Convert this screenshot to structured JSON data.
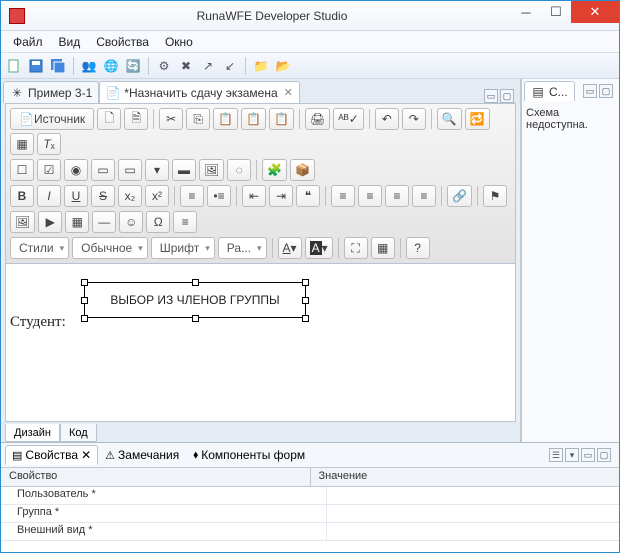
{
  "window": {
    "title": "RunaWFE Developer Studio"
  },
  "menu": {
    "file": "Файл",
    "view": "Вид",
    "properties": "Свойства",
    "window": "Окно"
  },
  "tabs": [
    {
      "label": "Пример 3-1"
    },
    {
      "label": "*Назначить сдачу экзамена"
    }
  ],
  "source_btn": "Источник",
  "style_combos": {
    "styles": "Стили",
    "format": "Обычное",
    "font": "Шрифт",
    "size": "Ра..."
  },
  "color_combo": {
    "a1": "A",
    "a2": "A"
  },
  "canvas": {
    "box_text": "ВЫБОР ИЗ ЧЛЕНОВ ГРУППЫ",
    "label": "Студент:"
  },
  "bottom_tabs": {
    "design": "Дизайн",
    "code": "Код"
  },
  "right": {
    "tab": "С...",
    "msg": "Схема недоступна."
  },
  "bottom_pane": {
    "tabs": {
      "props": "Свойства",
      "notes": "Замечания",
      "forms": "Компоненты форм"
    },
    "header": {
      "k": "Свойство",
      "v": "Значение"
    },
    "rows": [
      {
        "k": "Пользователь *"
      },
      {
        "k": "Группа *"
      },
      {
        "k": "Внешний вид *"
      }
    ]
  }
}
